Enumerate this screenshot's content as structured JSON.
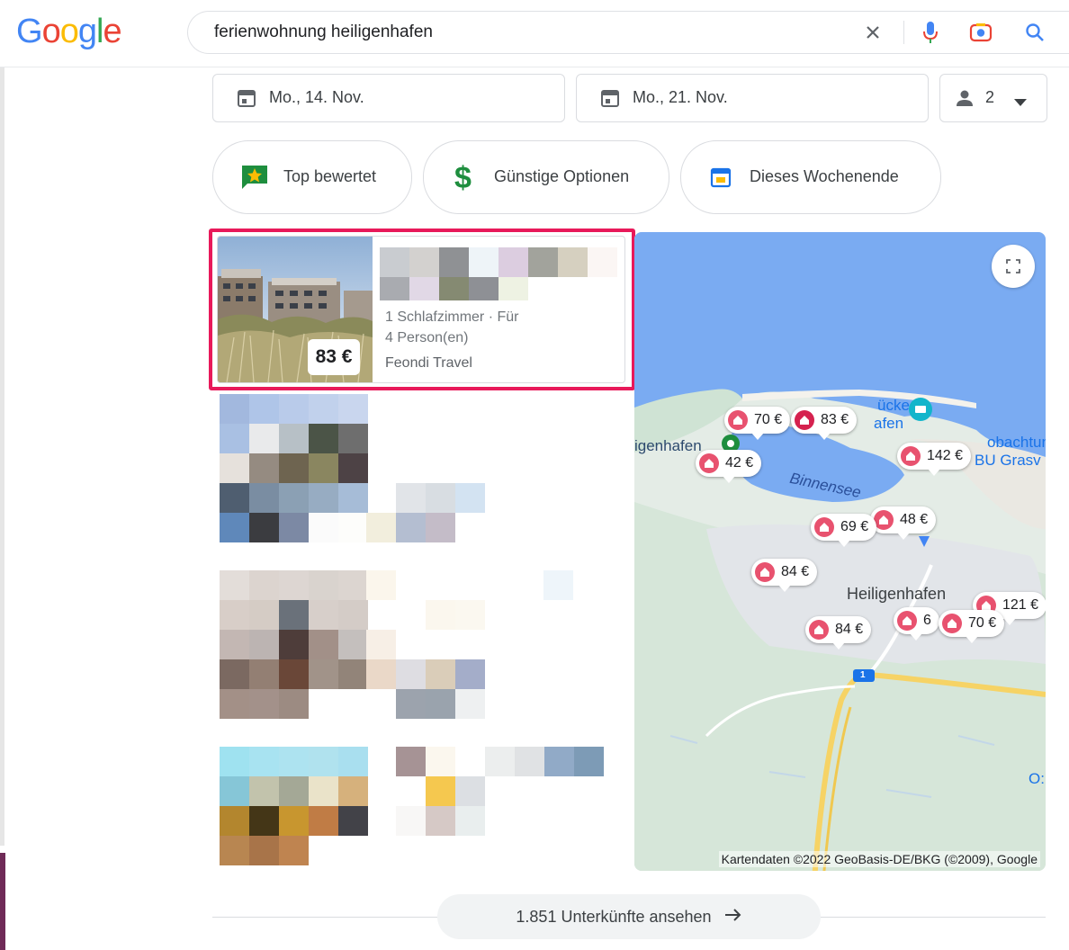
{
  "logo": {
    "letters": [
      "G",
      "o",
      "o",
      "g",
      "l",
      "e"
    ],
    "colors": [
      "#4285f4",
      "#ea4335",
      "#fbbc05",
      "#4285f4",
      "#34a853",
      "#ea4335"
    ]
  },
  "search": {
    "query": "ferienwohnung heiligenhafen"
  },
  "filters": {
    "checkin": "Mo., 14. Nov.",
    "checkout": "Mo., 21. Nov.",
    "guests": "2"
  },
  "chips": [
    {
      "label": "Top bewertet",
      "icon": "star-flag-icon"
    },
    {
      "label": "Günstige Optionen",
      "icon": "dollar-icon"
    },
    {
      "label": "Dieses Wochenende",
      "icon": "calendar-icon"
    }
  ],
  "listing": {
    "price": "83 €",
    "details_line1": "1 Schlafzimmer · Für",
    "details_line2": "4 Person(en)",
    "provider": "Feondi Travel"
  },
  "map": {
    "pins": [
      {
        "label": "70 €"
      },
      {
        "label": "83 €"
      },
      {
        "label": "42 €"
      },
      {
        "label": "142 €"
      },
      {
        "label": "48 €"
      },
      {
        "label": "69 €"
      },
      {
        "label": "84 €"
      },
      {
        "label": "121 €"
      },
      {
        "label": "84 €"
      },
      {
        "label": "6"
      },
      {
        "label": "70 €"
      }
    ],
    "labels": {
      "town": "Heiligenhafen",
      "lake": "Binnensee",
      "west": "igenhafen",
      "top_poi": "ücke",
      "top_poi2": "afen",
      "right_poi": "obachtun",
      "right_poi2": "BU Grasv",
      "east": "O:",
      "road": "1"
    },
    "attribution": "Kartendaten ©2022 GeoBasis-DE/BKG (©2009), Google"
  },
  "more_button": "1.851 Unterkünfte ansehen",
  "colors": {
    "accent": "#e8195a",
    "pin": "#e8526f",
    "water": "#7aabf2"
  }
}
